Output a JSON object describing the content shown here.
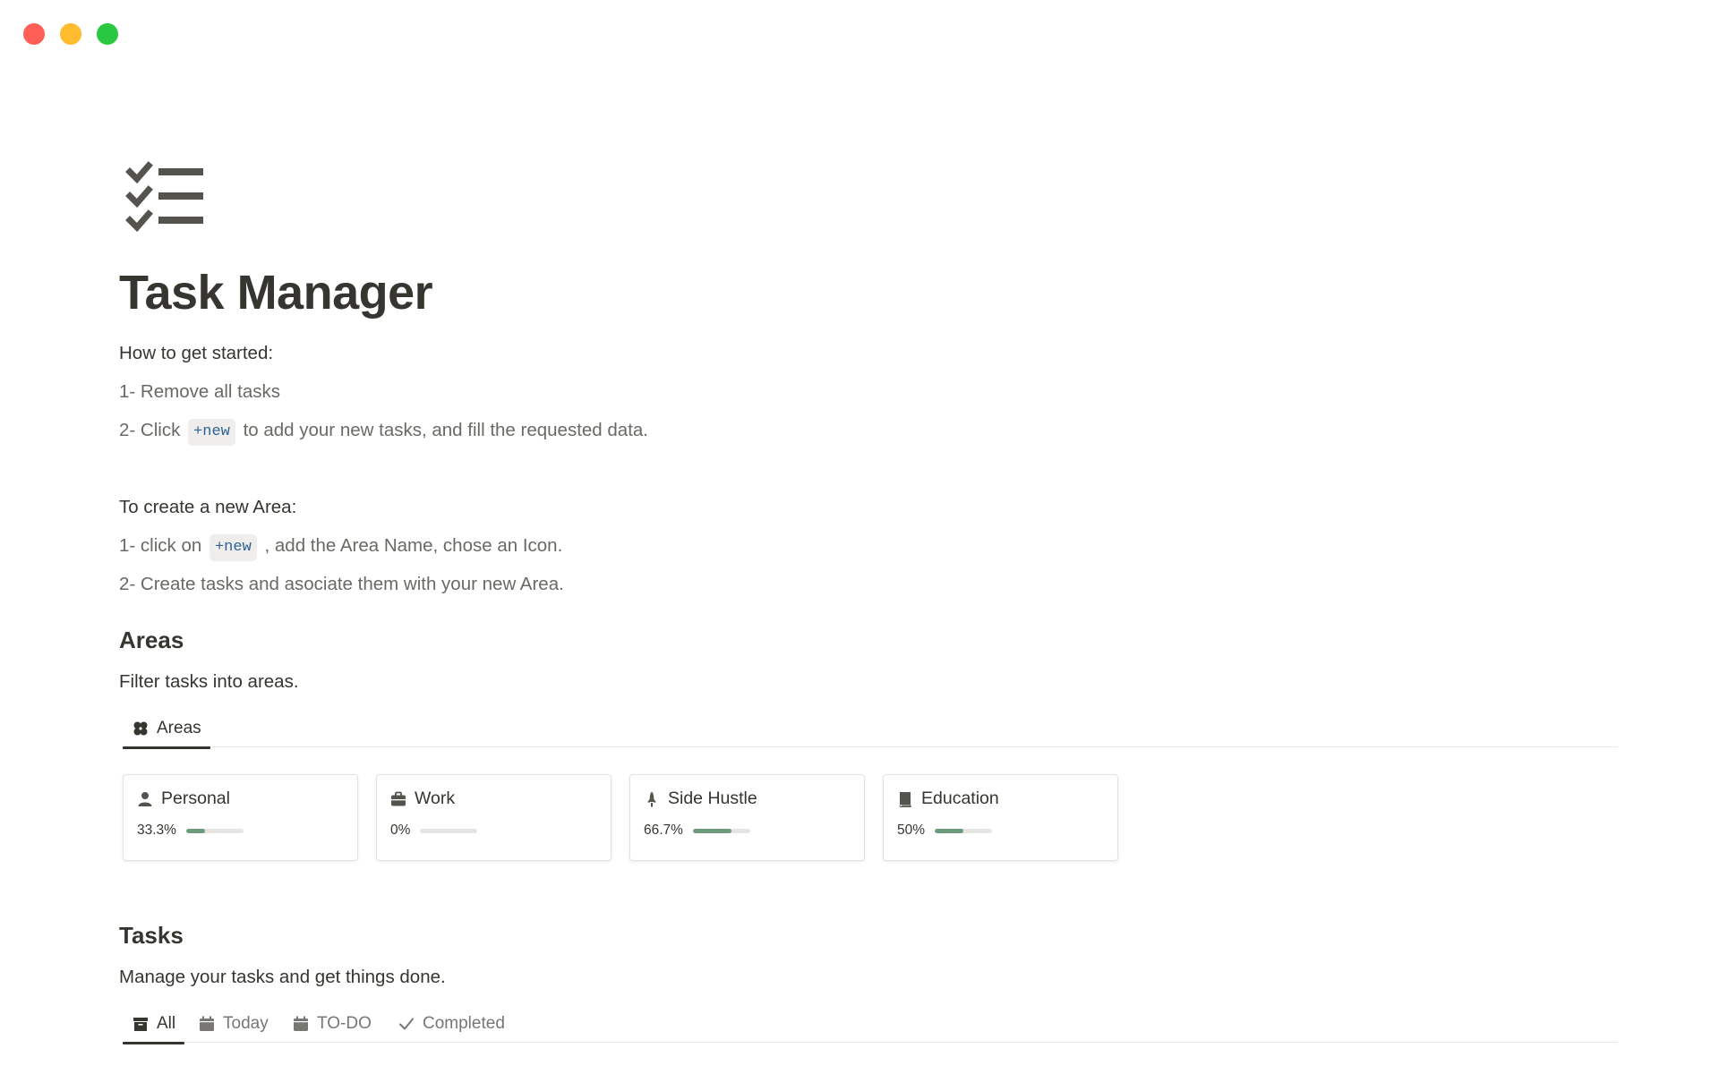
{
  "page": {
    "title": "Task Manager",
    "icon": "checklist-icon"
  },
  "intro": {
    "heading": "How to get started:",
    "step1": "1- Remove all tasks",
    "step2_pre": "2- Click",
    "step2_code": "+new",
    "step2_post": "to add your new tasks, and fill the requested data."
  },
  "area_help": {
    "heading": "To create a new Area:",
    "step1_pre": "1- click on",
    "step1_code": "+new",
    "step1_post": ", add the Area Name, chose an Icon.",
    "step2": "2- Create tasks and asociate them with your new Area."
  },
  "areas": {
    "heading": "Areas",
    "description": "Filter tasks into areas.",
    "tab": {
      "label": "Areas",
      "icon": "clover-icon"
    },
    "cards": [
      {
        "name": "Personal",
        "icon": "person-icon",
        "progress_label": "33.3%",
        "progress": 0.333
      },
      {
        "name": "Work",
        "icon": "briefcase-icon",
        "progress_label": "0%",
        "progress": 0
      },
      {
        "name": "Side Hustle",
        "icon": "rocket-icon",
        "progress_label": "66.7%",
        "progress": 0.667
      },
      {
        "name": "Education",
        "icon": "book-icon",
        "progress_label": "50%",
        "progress": 0.5
      }
    ]
  },
  "tasks": {
    "heading": "Tasks",
    "description": "Manage your tasks and get things done.",
    "tabs": [
      {
        "label": "All",
        "icon": "archive-icon",
        "active": true
      },
      {
        "label": "Today",
        "icon": "calendar-icon",
        "active": false
      },
      {
        "label": "TO-DO",
        "icon": "calendar-icon",
        "active": false
      },
      {
        "label": "Completed",
        "icon": "checkmark-icon",
        "active": false
      }
    ]
  },
  "colors": {
    "progress_fill": "#6c9b7d",
    "code_text": "#2f6296",
    "text": "#37352f"
  }
}
